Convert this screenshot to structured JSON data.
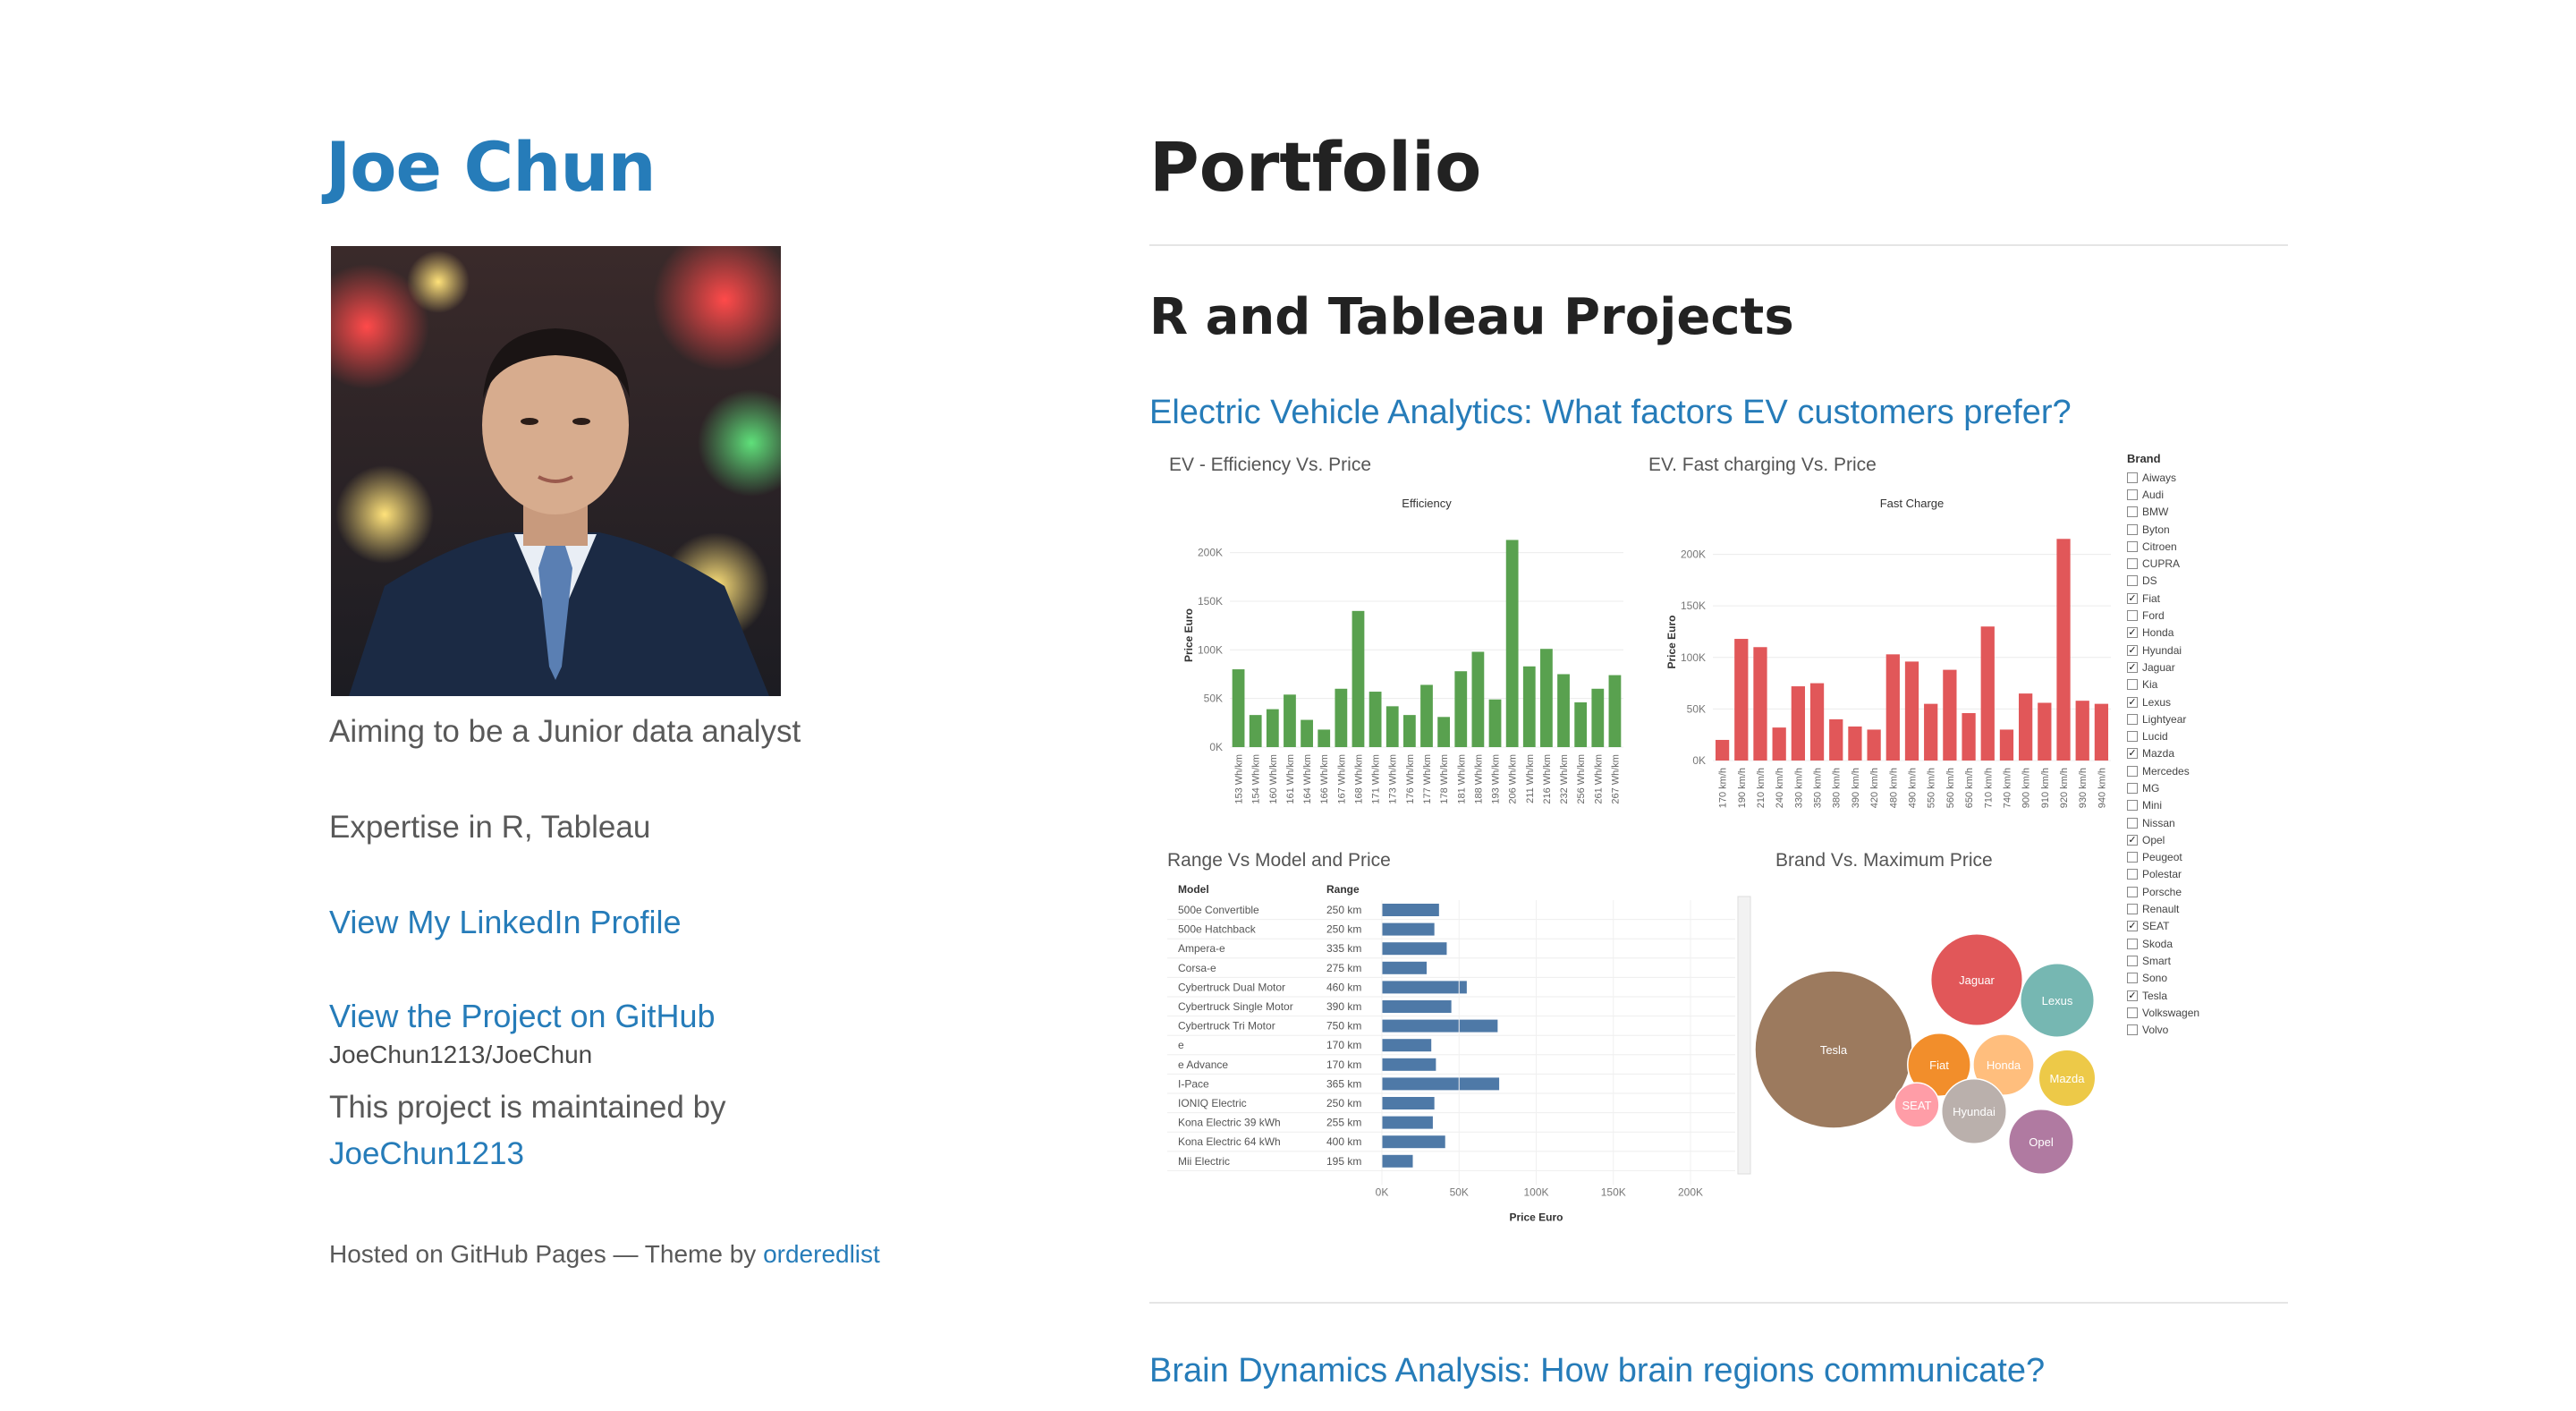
{
  "sidebar": {
    "name": "Joe Chun",
    "tagline": "Aiming to be a Junior data analyst",
    "expertise": "Expertise in R, Tableau",
    "linkedin": "View My LinkedIn Profile",
    "github_link": "View the Project on GitHub",
    "repo": "JoeChun1213/JoeChun",
    "maintained_prefix": "This project is maintained by",
    "maintainer": "JoeChun1213",
    "hosted_prefix": "Hosted on GitHub Pages — Theme by",
    "theme_author": "orderedlist"
  },
  "main": {
    "title": "Portfolio",
    "section": "R and Tableau Projects",
    "projects": [
      {
        "label": "Electric Vehicle Analytics: What factors EV customers prefer?"
      },
      {
        "label": "Brain Dynamics Analysis: How brain regions communicate?"
      }
    ]
  },
  "colors": {
    "link": "#267CB9",
    "efficiency_bars": "#59A14F",
    "fastcharge_bars": "#E15759",
    "range_bars": "#4E79A7"
  },
  "chart_data": [
    {
      "type": "bar",
      "title": "EV - Efficiency Vs. Price",
      "subtitle": "Efficiency",
      "ylabel": "Price Euro",
      "ylim": [
        0,
        230000
      ],
      "yticks": [
        "0K",
        "50K",
        "100K",
        "150K",
        "200K"
      ],
      "categories": [
        "153 Wh/km",
        "154 Wh/km",
        "160 Wh/km",
        "161 Wh/km",
        "164 Wh/km",
        "166 Wh/km",
        "167 Wh/km",
        "168 Wh/km",
        "171 Wh/km",
        "173 Wh/km",
        "176 Wh/km",
        "177 Wh/km",
        "178 Wh/km",
        "181 Wh/km",
        "188 Wh/km",
        "193 Wh/km",
        "206 Wh/km",
        "211 Wh/km",
        "216 Wh/km",
        "232 Wh/km",
        "256 Wh/km",
        "261 Wh/km",
        "267 Wh/km"
      ],
      "values": [
        80000,
        33000,
        39000,
        54000,
        28000,
        18000,
        60000,
        140000,
        57000,
        42000,
        33000,
        64000,
        31000,
        78000,
        98000,
        49000,
        213000,
        83000,
        101000,
        75000,
        46000,
        60000,
        74000
      ]
    },
    {
      "type": "bar",
      "title": "EV. Fast charging Vs. Price",
      "subtitle": "Fast Charge",
      "ylabel": "Price Euro",
      "ylim": [
        0,
        230000
      ],
      "yticks": [
        "0K",
        "50K",
        "100K",
        "150K",
        "200K"
      ],
      "categories": [
        "170 km/h",
        "190 km/h",
        "210 km/h",
        "240 km/h",
        "330 km/h",
        "350 km/h",
        "380 km/h",
        "390 km/h",
        "420 km/h",
        "480 km/h",
        "490 km/h",
        "550 km/h",
        "560 km/h",
        "650 km/h",
        "710 km/h",
        "740 km/h",
        "900 km/h",
        "910 km/h",
        "920 km/h",
        "930 km/h",
        "940 km/h"
      ],
      "values": [
        20000,
        118000,
        110000,
        32000,
        72000,
        75000,
        40000,
        33000,
        30000,
        103000,
        96000,
        55000,
        88000,
        46000,
        130000,
        30000,
        65000,
        56000,
        215000,
        58000,
        55000
      ]
    },
    {
      "type": "bar",
      "orientation": "horizontal",
      "title": "Range Vs Model and Price",
      "columns": [
        "Model",
        "Range"
      ],
      "xlabel": "Price Euro",
      "xticks": [
        "0K",
        "50K",
        "100K",
        "150K",
        "200K"
      ],
      "xlim": [
        0,
        200000
      ],
      "rows": [
        {
          "model": "500e Convertible",
          "range": "250 km",
          "value": 37000
        },
        {
          "model": "500e Hatchback",
          "range": "250 km",
          "value": 34000
        },
        {
          "model": "Ampera-e",
          "range": "335 km",
          "value": 42000
        },
        {
          "model": "Corsa-e",
          "range": "275 km",
          "value": 29000
        },
        {
          "model": "Cybertruck Dual Motor",
          "range": "460 km",
          "value": 55000
        },
        {
          "model": "Cybertruck Single Motor",
          "range": "390 km",
          "value": 45000
        },
        {
          "model": "Cybertruck Tri Motor",
          "range": "750 km",
          "value": 75000
        },
        {
          "model": "e",
          "range": "170 km",
          "value": 32000
        },
        {
          "model": "e Advance",
          "range": "170 km",
          "value": 35000
        },
        {
          "model": "I-Pace",
          "range": "365 km",
          "value": 76000
        },
        {
          "model": "IONIQ Electric",
          "range": "250 km",
          "value": 34000
        },
        {
          "model": "Kona Electric 39 kWh",
          "range": "255 km",
          "value": 33000
        },
        {
          "model": "Kona Electric 64 kWh",
          "range": "400 km",
          "value": 41000
        },
        {
          "model": "Mii Electric",
          "range": "195 km",
          "value": 20000
        }
      ]
    },
    {
      "type": "bubble",
      "title": "Brand Vs. Maximum Price",
      "bubbles": [
        {
          "label": "Tesla",
          "value": 100,
          "color": "#9C7A5E"
        },
        {
          "label": "Jaguar",
          "value": 34,
          "color": "#E15759"
        },
        {
          "label": "Lexus",
          "value": 22,
          "color": "#76B7B2"
        },
        {
          "label": "Fiat",
          "value": 16,
          "color": "#F28E2B"
        },
        {
          "label": "Honda",
          "value": 15,
          "color": "#FFBE7D"
        },
        {
          "label": "Mazda",
          "value": 13,
          "color": "#EDC948"
        },
        {
          "label": "SEAT",
          "value": 8,
          "color": "#FF9DA7"
        },
        {
          "label": "Hyundai",
          "value": 17,
          "color": "#BAB0AC"
        },
        {
          "label": "Opel",
          "value": 17,
          "color": "#B07AA1"
        }
      ]
    }
  ],
  "legend": {
    "title": "Brand",
    "items": [
      {
        "name": "Aiways",
        "checked": false
      },
      {
        "name": "Audi",
        "checked": false
      },
      {
        "name": "BMW",
        "checked": false
      },
      {
        "name": "Byton",
        "checked": false
      },
      {
        "name": "Citroen",
        "checked": false
      },
      {
        "name": "CUPRA",
        "checked": false
      },
      {
        "name": "DS",
        "checked": false
      },
      {
        "name": "Fiat",
        "checked": true
      },
      {
        "name": "Ford",
        "checked": false
      },
      {
        "name": "Honda",
        "checked": true
      },
      {
        "name": "Hyundai",
        "checked": true
      },
      {
        "name": "Jaguar",
        "checked": true
      },
      {
        "name": "Kia",
        "checked": false
      },
      {
        "name": "Lexus",
        "checked": true
      },
      {
        "name": "Lightyear",
        "checked": false
      },
      {
        "name": "Lucid",
        "checked": false
      },
      {
        "name": "Mazda",
        "checked": true
      },
      {
        "name": "Mercedes",
        "checked": false
      },
      {
        "name": "MG",
        "checked": false
      },
      {
        "name": "Mini",
        "checked": false
      },
      {
        "name": "Nissan",
        "checked": false
      },
      {
        "name": "Opel",
        "checked": true
      },
      {
        "name": "Peugeot",
        "checked": false
      },
      {
        "name": "Polestar",
        "checked": false
      },
      {
        "name": "Porsche",
        "checked": false
      },
      {
        "name": "Renault",
        "checked": false
      },
      {
        "name": "SEAT",
        "checked": true
      },
      {
        "name": "Skoda",
        "checked": false
      },
      {
        "name": "Smart",
        "checked": false
      },
      {
        "name": "Sono",
        "checked": false
      },
      {
        "name": "Tesla",
        "checked": true
      },
      {
        "name": "Volkswagen",
        "checked": false
      },
      {
        "name": "Volvo",
        "checked": false
      }
    ]
  }
}
